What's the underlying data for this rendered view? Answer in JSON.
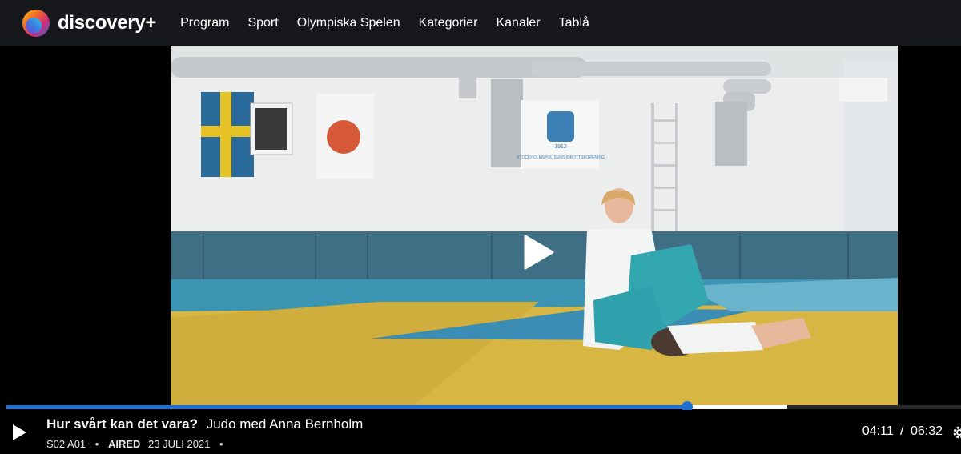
{
  "app": {
    "logo_text": "discovery+"
  },
  "nav": {
    "items": [
      {
        "label": "Program"
      },
      {
        "label": "Sport"
      },
      {
        "label": "Olympiska Spelen"
      },
      {
        "label": "Kategorier"
      },
      {
        "label": "Kanaler"
      },
      {
        "label": "Tablå"
      }
    ]
  },
  "video": {
    "flag_text": "STOCKHOLMSPOLISENS IDROTTSFÖRENING",
    "flag_year": "1912"
  },
  "player": {
    "progress_fraction": 0.713,
    "buffer_fraction": 0.818,
    "show_title": "Hur svårt kan det vara?",
    "episode_title": "Judo med Anna Bernholm",
    "episode_code": "S02 A01",
    "aired_label": "AIRED",
    "aired_date": "23 JULI 2021",
    "separator": "•",
    "current_time": "04:11",
    "time_separator": "/",
    "duration": "06:32"
  },
  "colors": {
    "accent": "#1f6fd0",
    "topbar": "#17181c"
  },
  "icons": {
    "play_overlay": "play-icon",
    "play_control": "play-icon",
    "settings": "gear-icon"
  }
}
